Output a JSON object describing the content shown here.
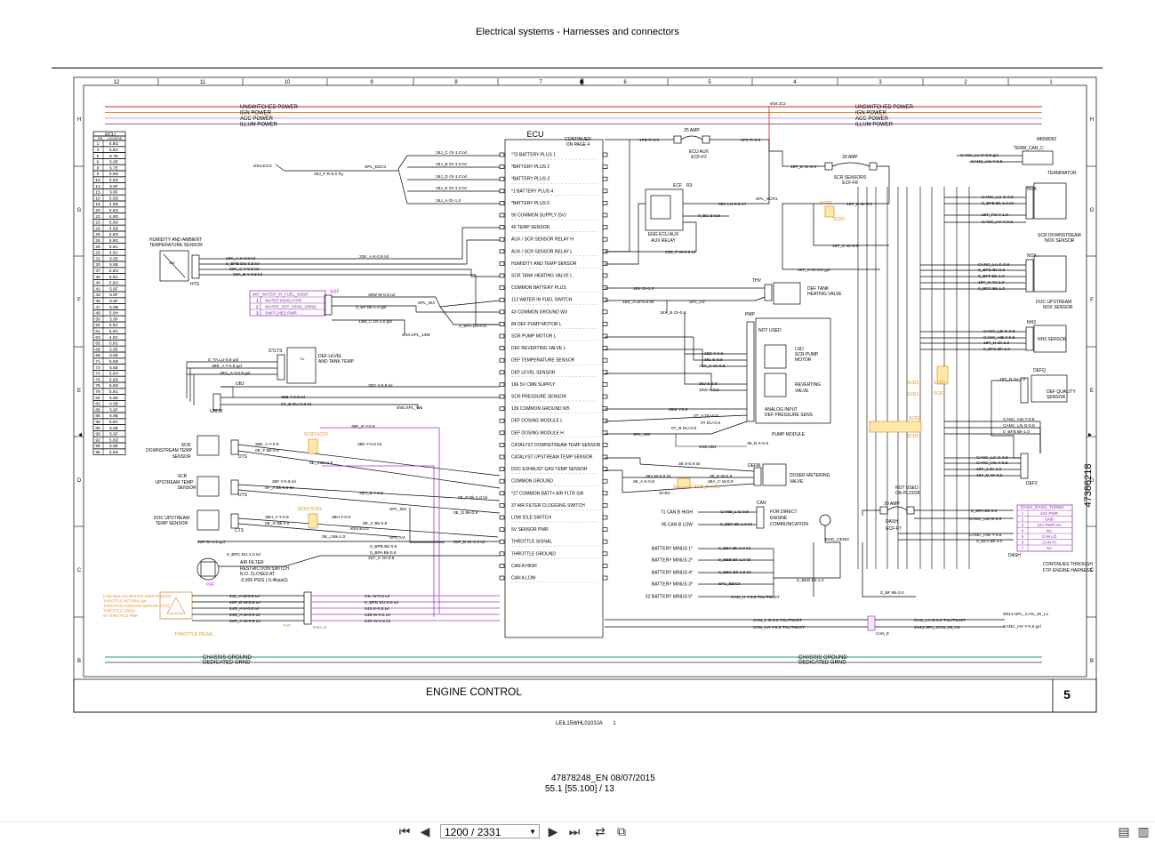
{
  "header": {
    "title": "Electrical systems - Harnesses and connectors"
  },
  "grid": {
    "columns": [
      "12",
      "11",
      "10",
      "9",
      "8",
      "7",
      "6",
      "5",
      "4",
      "3",
      "2",
      "1"
    ],
    "rows": [
      "H",
      "G",
      "F",
      "E",
      "D",
      "C",
      "B"
    ]
  },
  "buses_top": [
    "UNSWITCHED POWER",
    "IGN POWER",
    "ACC POWER",
    "ILLUM POWER"
  ],
  "buses_bottom": [
    "CHASSIS GROUND",
    "DEDICATED GRND"
  ],
  "bus_colors": {
    "unswitched": "#d62020",
    "ign": "#e88a2a",
    "acc": "#c79ad0",
    "illum": "#8a5fb5",
    "chassis": "#2a9a6a",
    "dedicated": "#666666"
  },
  "ecu": {
    "title": "ECU",
    "continued": [
      "CONTINUED",
      "ON PAGE 4"
    ],
    "pins_left": [
      "*73 BATTERY PLUS 1",
      "*BATTERY PLUS 2",
      "*BATTERY PLUS 3",
      "*1 BATTERY PLUS 4",
      "*BATTERY PLUS 5",
      "90 COMMON SUPPLY (5V)",
      "40 TEMP SENSOR",
      "AUX / SCR SENSOR RELAY H",
      "AUX / SCR SENSOR RELAY L",
      "HUMIDITY AND TEMP SENSOR",
      "SCR TANK HEATING VALVE L",
      "COMMON BATTERY PLUS",
      "113 WATER IN FUEL SWITCH",
      "43 COMMON GROUND W3",
      "84 DEF PUMP MOTOR L",
      "SCR PUMP MOTOR L",
      "DEF REVERTING VALVE L",
      "DEF TEMPERATURE SENSOR",
      "DEF LEVEL SENSOR",
      "166 5V CMN SUPPLY",
      "SCR PRESSURE SENSOR",
      "139 COMMON GROUND W5",
      "DEF DOSING MODULE L",
      "DEF DOSING MODULE H",
      "CATALYST DOWNSTREAM TEMP SENSOR",
      "CATALYST UPSTREAM TEMP SENSOR",
      "DOC EXHAUST GAS TEMP SENSOR",
      "COMMON GROUND",
      "*27 COMMON BATT+ AIR FLTR SW",
      "37 AIR FILTER CLOGGING SWITCH",
      "LOW IDLE SWITCH",
      "5V SENSOR PWR",
      "THROTTLE SIGNAL",
      "THROTTLE GROUND",
      "CAN A HIGH",
      "CAN A LOW"
    ],
    "pins_right": [
      "71 CAN B HIGH",
      "95 CAN B LOW",
      "BATTERY MINUS 1*",
      "BATTERY MINUS 2*",
      "BATTERY MINUS 3*",
      "BATTERY MINUS 4*",
      "52 BATTERY MINUS 5*"
    ]
  },
  "location_table": {
    "title": "ECU",
    "headers": [
      "PIN",
      "LOCATION"
    ],
    "rows": [
      [
        "1",
        "5.8G"
      ],
      [
        "3",
        "5.5C"
      ],
      [
        "5",
        "5.7E"
      ],
      [
        "6",
        "5.8E"
      ],
      [
        "8",
        "5.7E"
      ],
      [
        "9",
        "5.8D"
      ],
      [
        "10",
        "5.8D"
      ],
      [
        "13",
        "5.8F"
      ],
      [
        "15",
        "5.8F"
      ],
      [
        "16",
        "5.8D"
      ],
      [
        "19",
        "4.9D"
      ],
      [
        "20",
        "5.6G"
      ],
      [
        "22",
        "4.9D"
      ],
      [
        "23",
        "5.6D"
      ],
      [
        "24",
        "4.9D"
      ],
      [
        "25",
        "5.8G"
      ],
      [
        "26",
        "5.8G"
      ],
      [
        "28",
        "5.5C"
      ],
      [
        "29",
        "4.9C"
      ],
      [
        "31",
        "5.5E"
      ],
      [
        "33",
        "5.5E"
      ],
      [
        "37",
        "5.8G"
      ],
      [
        "39",
        "5.8C"
      ],
      [
        "40",
        "5.6G"
      ],
      [
        "41",
        "5.6F"
      ],
      [
        "43",
        "5.6F"
      ],
      [
        "45",
        "5.6F"
      ],
      [
        "47",
        "5.6B"
      ],
      [
        "49",
        "5.9H"
      ],
      [
        "50",
        "5.6F"
      ],
      [
        "52",
        "5.5C"
      ],
      [
        "61",
        "5.9C"
      ],
      [
        "63",
        "4.9C"
      ],
      [
        "65",
        "5.8C"
      ],
      [
        "68",
        "5.6E"
      ],
      [
        "69",
        "5.6E"
      ],
      [
        "71",
        "5.8D"
      ],
      [
        "73",
        "5.6E"
      ],
      [
        "74",
        "5.8H"
      ],
      [
        "75",
        "5.6D"
      ],
      [
        "76",
        "5.6D"
      ],
      [
        "79",
        "5.8C"
      ],
      [
        "82",
        "5.6E"
      ],
      [
        "83",
        "4.9B"
      ],
      [
        "85",
        "5.6F"
      ],
      [
        "86",
        "5.8E"
      ],
      [
        "88",
        "5.8C"
      ],
      [
        "89",
        "5.8E"
      ],
      [
        "90",
        "5.6F"
      ],
      [
        "92",
        "5.8D"
      ],
      [
        "95",
        "5.8E"
      ],
      [
        "96",
        "5.6D"
      ]
    ]
  },
  "components": {
    "hts": [
      "HUMIDITY AND AMBIENT",
      "TEMPERATURE SENSOR",
      "HTS"
    ],
    "wif": {
      "tag": "WIF",
      "rows": [
        "WIF_WATER_IN_FUEL_SNSR",
        "WATER INDICATOR",
        "WATER_SEP_SENS_GRND",
        "SWITCHED PWR"
      ]
    },
    "dtlts": [
      "DTLTS",
      "DEF LEVEL",
      "AND TANK TEMP"
    ],
    "ubj": "UBJ",
    "ublm": "UBLM",
    "scr_down": [
      "SCR",
      "DOWNSTREAM TEMP",
      "SENSOR",
      "DTS"
    ],
    "scr_up": [
      "SCR",
      "UPSTREAM TEMP",
      "SENSOR",
      "UTS"
    ],
    "doc_up": [
      "DOC UPSTREAM",
      "TEMP SENSOR",
      "CTS"
    ],
    "paf": [
      "PAF",
      "AIR FILTER",
      "RESTRICTION SWITCH",
      "N.O. CLOSES AT",
      "-0.926 PSIG (-6.4KpaG)"
    ],
    "throttle": [
      "LOW IDLE VALIDATION SWITCH (LIVS)",
      "THROTTLE RETURN SW",
      "THROTTLE POSITION SENSOR (TPS)",
      "THROTTLE GRND",
      "5V THROTTLE PWR",
      "THROTTLE PEDAL",
      "THR",
      "ENG_B"
    ],
    "eng_ecu_aux": [
      "ECF",
      "ENG ECU AUX",
      "AUX RELAY",
      "R3"
    ],
    "ecu_aux_fuse": [
      "25 AMP",
      "ECU AUX",
      "ECF-F2"
    ],
    "scr_fuse": [
      "20 AMP",
      "SCR SENSORS",
      "ECF-F8"
    ],
    "dash_fuse": [
      "20 AMP",
      "DASH",
      "ECF-F7"
    ],
    "thv": [
      "THV",
      "DEF TANK",
      "HEATING VALVE"
    ],
    "pmp": [
      "PMP",
      "NOT USED",
      "LSD",
      "SCR PUMP",
      "MOTOR",
      "REVERTING",
      "VALVE",
      "ANALOG INPUT",
      "DEF PRESSURE SENS",
      "PUMP MODULE"
    ],
    "defm": [
      "DEFM",
      "DOSER METERING",
      "VALVE"
    ],
    "can": [
      "CAN",
      "FOR DIRECT",
      "ENGINE",
      "COMMUNICATION"
    ],
    "nox_down": [
      "NOX",
      "SCR DOWNSTREAM",
      "NOX SENSOR"
    ],
    "nox_up": [
      "NOX",
      "DOC UPSTREAM",
      "NOX SENSOR"
    ],
    "nh3": [
      "NH3",
      "NH3 SENSOR"
    ],
    "defq": [
      "DEFQ",
      "DEF QUALITY",
      "SENSOR",
      "DEF2",
      "DEF1"
    ],
    "term": [
      "84058092",
      "TERM_CAN_C",
      "TERMINATOR"
    ],
    "dash": {
      "title": "DASH_DASH_TURBO",
      "rows": [
        "24V PWR",
        "GND",
        "12V PWR NA",
        "NA",
        "CAN LO",
        "CAN HI",
        "NA"
      ],
      "label": "DASH",
      "note": [
        "CONTINUES THROUGH",
        "FTP ENGINE HARNESS"
      ]
    },
    "not_used_dash": [
      "NOT USED",
      "ON PL23/26"
    ],
    "can_e": "CAN_E",
    "eng_ceng": "ENG_CENG"
  },
  "wire_labels": [
    "18J_C Or-1.0 txl",
    "18J_B Or-1.0 txl",
    "18J_D Or-1.0 txl",
    "18J_E Or-1.0 txl",
    "18J_A Or-1.0",
    "18J_F R-6.0 fry",
    "SPL_EDC2",
    "sht4.ECG",
    "23K_A K-0.8 txl",
    "23K_A K-0.8 txl",
    "0_BPB DU-0.8 txl",
    "23K_C Y-0.8 txl",
    "23K_B Y-0.8 txl",
    "35W W-0.8 txl",
    "0_BP Bk-1.0 gxl",
    "13M_C Or-1.0 gxl",
    "SPL_W3",
    "0_BPA DU-0.8",
    "sht4.SPL_13M",
    "0_TA LU-0.8 gxl",
    "38B_A Y-0.8 gxl",
    "38G_A Y-0.8 gxl",
    "38G Y-0.8 txl",
    "38B Y-0.8 txl",
    "0T_B DU-0.8 txl",
    "sht5.SPL_W5",
    "38E_B Y-0.8",
    "38E_A Y-0.8",
    "0E_F Bk-0.8",
    "38E Y-0.8 txl",
    "0E_J Bk-0.8",
    "0E_B Bk-1.0 txl",
    "38F Y-0.8 txl",
    "0F_A Bk-0.8 txl",
    "38H_B Y-0.8",
    "38H_A Y-0.8",
    "38H Y-0.8",
    "0E_G Bk-0.8",
    "0E_C Bk-0.8",
    "sht4.ECG",
    "0E_J Bk-1.0",
    "SPL_W4",
    "0E_D Bk-0.8",
    "31F Or-1.0 gxl",
    "31F_B Or-1.0 txl",
    "0_BPC DU-1.0 txl",
    "31F_C Or-0.8",
    "0_BPB Bk-0.8",
    "0_BPA Bk-0.8",
    "24L_A W-0.8 txl",
    "21F_D W-0.8 txl",
    "24S_A K-0.8 txl",
    "24B_A W-0.8 txl",
    "24R_A W-0.8 txl",
    "24L W-0.8 txl",
    "0_BPD DU-0.8 txl",
    "24S K-0.8 txl",
    "24B W-0.8 txl",
    "24R W-0.8 txl",
    "1FD R-3.0",
    "1FC R-3.0",
    "sht4.JC2",
    "18T_B Or-2.0",
    "18T_E Or-2.0",
    "18T_K Or-2.0",
    "18T_C Or-3.0",
    "18T_A Or-3.0 gxl",
    "SPL_SCR1",
    "0_BC S-0.8",
    "23B_F W-0.8 txl",
    "38C LU-0.8 txl",
    "18X Or-1.0",
    "18X_A Or-0.8 txl",
    "SPL_V3",
    "18X_B Or-0.8",
    "38D Y-0.8",
    "38L S-0.8",
    "18X_C Or-0.8",
    "38J S-0.8",
    "18W K-0.8",
    "38M Y-0.8",
    "0T_A DU-0.8",
    "0T DU-0.8",
    "SPL_W5",
    "0T_B DU-0.8",
    "sht5.UBJ",
    "38_B S-0.8",
    "38 S-0.8 txl",
    "38A W-0.8 txl",
    "38_A S-0.8",
    "38_B W-0.8",
    "38A_C W-0.8",
    "SCR2",
    "SCR1",
    "CANB_H Y-0.8",
    "CANB_L G-0.8",
    "0_BEF Bk-1.0 txl",
    "0_BEA Bk-1.0 txl",
    "0_BEB Bk-1.0 txl",
    "0_BEC Bk-1.0 txl",
    "SPL_EDC3",
    "0_BED Bk-1.0",
    "CAN_H Y-0.8 TXL/TWIST",
    "CAN_L G-0.8 TXL/TWIST",
    "CAN_HA Y-0.8 TXL/TWIST",
    "CAN_LA G-0.8 TXL/TWIST",
    "sht12.SPL_CAN_JS_H1",
    "sht12.SPL_CAN_JS_L1",
    "CANC_HV Y-0.8 gxl",
    "CANC_LV G-0.8 gxl",
    "CANC_HU Y-0.8",
    "CANC_LU G-0.8",
    "0_BFE Bk-1.0 txl",
    "18T_FO Y-1.0",
    "CANC_HA Y-0.8",
    "CANC_LA G-0.8",
    "0_BFD Bk-0.8",
    "0_BFP Bk-1.0",
    "18T_G Or-1.0",
    "0_BFC Bk-1.0",
    "CANC_LB G-0.8",
    "CANC_HB Y-0.8",
    "18T_H Or-1.0",
    "0_BFK Bk-1.0",
    "18T_N Or-1.0",
    "CANC_HN Y-0.8",
    "CANC_LN G-0.8",
    "0_BFB Bk-1.0",
    "CANC_LC G-0.8",
    "CANC_HC Y-0.8",
    "18T_J Or-1.0",
    "18T_D Or-3.0",
    "0_BFA Bk-3.0",
    "CANC_LW G-0.8",
    "CANC_HW Y-0.8",
    "0_BFA Bk-3.0",
    "0_BF Bk-3.0"
  ],
  "title_block": {
    "name": "ENGINE CONTROL",
    "page": "5",
    "side_number": "47386218"
  },
  "footer": {
    "code": "LEIL15WHL0103JA",
    "code_page": "1",
    "doc_id": "47878248_EN 08/07/2015",
    "page_ref": "55.1 [55.100] / 13"
  },
  "toolbar": {
    "page_indicator": "1200 / 2331"
  }
}
